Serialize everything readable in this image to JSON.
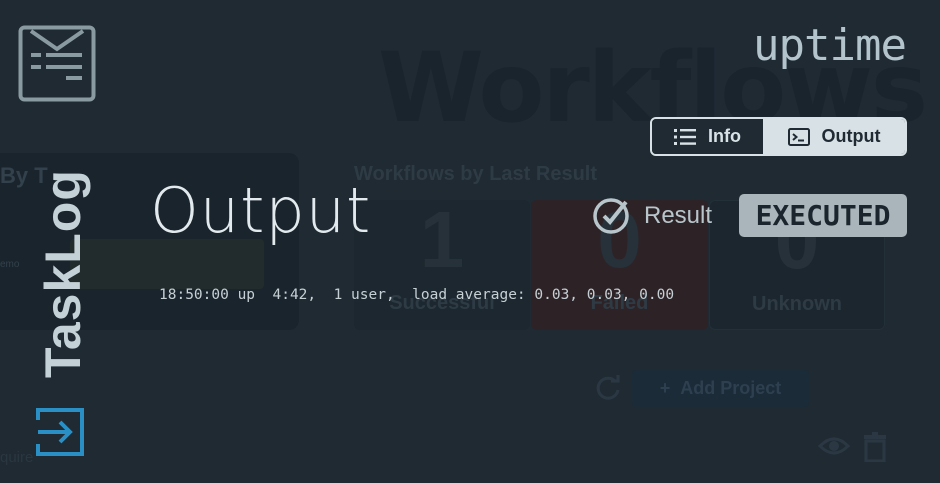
{
  "background": {
    "page_title": "Workflows",
    "left_card_title": "By T",
    "left_card_label": "emo",
    "section_title": "Workflows by Last Result",
    "tiles": [
      {
        "count": "1",
        "label": "Successful"
      },
      {
        "count": "0",
        "label": "Failed"
      },
      {
        "count": "0",
        "label": "Unknown"
      }
    ],
    "add_project_label": "Add Project",
    "bottom_text": "quire"
  },
  "brand": {
    "name": "TaskLog"
  },
  "command": {
    "name": "uptime"
  },
  "tabs": [
    {
      "label": "Info",
      "icon": "list-icon",
      "active": false
    },
    {
      "label": "Output",
      "icon": "terminal-icon",
      "active": true
    }
  ],
  "output": {
    "heading": "Output",
    "result_label": "Result",
    "status": "EXECUTED",
    "text": "18:50:00 up  4:42,  1 user,  load average: 0.03, 0.03, 0.00"
  },
  "colors": {
    "background": "#1f2a33",
    "text_primary": "#e2eaee",
    "badge_bg": "#a9b5ba",
    "exit_icon": "#2a8fc4",
    "tab_active_bg": "#d8e2e6"
  }
}
